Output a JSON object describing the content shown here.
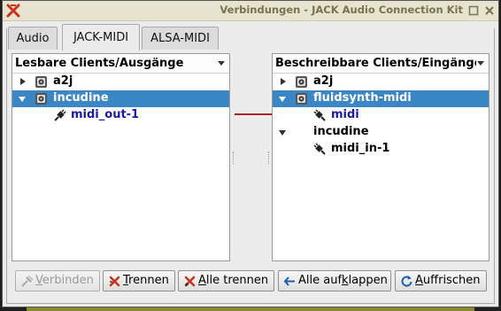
{
  "window": {
    "title": "Verbindungen - JACK Audio Connection Kit"
  },
  "tabs": [
    "Audio",
    "JACK-MIDI",
    "ALSA-MIDI"
  ],
  "active_tab": "JACK-MIDI",
  "left_panel": {
    "header": "Lesbare Clients/Ausgänge",
    "items": [
      {
        "label": "a2j",
        "expanded": false,
        "selected": false
      },
      {
        "label": "incudine",
        "expanded": true,
        "selected": true
      },
      {
        "label": "midi_out-1",
        "port": true
      }
    ]
  },
  "right_panel": {
    "header": "Beschreibbare Clients/Eingänge",
    "items": [
      {
        "label": "a2j",
        "expanded": false,
        "selected": false
      },
      {
        "label": "fluidsynth-midi",
        "expanded": true,
        "selected": true
      },
      {
        "label": "midi",
        "port": true
      },
      {
        "label": "incudine",
        "expanded": true,
        "selected": false
      },
      {
        "label": "midi_in-1",
        "port": true
      }
    ]
  },
  "buttons": {
    "connect": {
      "pre": "",
      "accel": "V",
      "post": "erbinden",
      "enabled": false
    },
    "disconnect": {
      "pre": "",
      "accel": "T",
      "post": "rennen",
      "enabled": true
    },
    "disconnect_all": {
      "pre": "",
      "accel": "A",
      "post": "lle trennen",
      "enabled": true
    },
    "expand_all": {
      "pre": "Alle auf",
      "accel": "k",
      "post": "lappen",
      "enabled": true
    },
    "refresh": {
      "pre": "",
      "accel": "A",
      "post": "uffrischen",
      "enabled": true
    }
  },
  "colors": {
    "selection": "#3b86c4",
    "connection_line": "#b02020",
    "port_text": "#1a1aa6"
  }
}
